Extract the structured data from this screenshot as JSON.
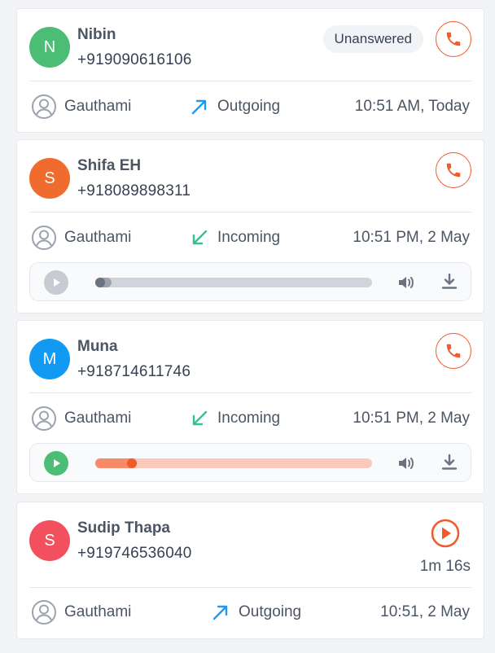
{
  "colors": {
    "accent": "#f15a2b",
    "outgoing_arrow": "#1e9bf0",
    "incoming_arrow": "#34c38f",
    "avatar_green": "#4cbd74",
    "avatar_orange": "#f06b2e",
    "avatar_blue": "#129af2",
    "avatar_red": "#f2505f"
  },
  "calls": [
    {
      "initial": "N",
      "name": "Nibin",
      "phone": "+919090616106",
      "status_badge": "Unanswered",
      "agent": "Gauthami",
      "direction": "Outgoing",
      "direction_icon": "arrow-up-right-icon",
      "time": "10:51 AM, Today"
    },
    {
      "initial": "S",
      "name": "Shifa EH",
      "phone": "+918089898311",
      "agent": "Gauthami",
      "direction": "Incoming",
      "direction_icon": "arrow-down-left-icon",
      "time": "10:51 PM, 2 May",
      "recording": {
        "state": "paused",
        "progress": 0.02
      }
    },
    {
      "initial": "M",
      "name": "Muna",
      "phone": "+918714611746",
      "agent": "Gauthami",
      "direction": "Incoming",
      "direction_icon": "arrow-down-left-icon",
      "time": "10:51 PM, 2 May",
      "recording": {
        "state": "ready",
        "progress": 0.15
      }
    },
    {
      "initial": "S",
      "name": "Sudip Thapa",
      "phone": "+919746536040",
      "duration": "1m 16s",
      "agent": "Gauthami",
      "direction": "Outgoing",
      "direction_icon": "arrow-up-right-icon",
      "time": "10:51, 2 May"
    }
  ]
}
